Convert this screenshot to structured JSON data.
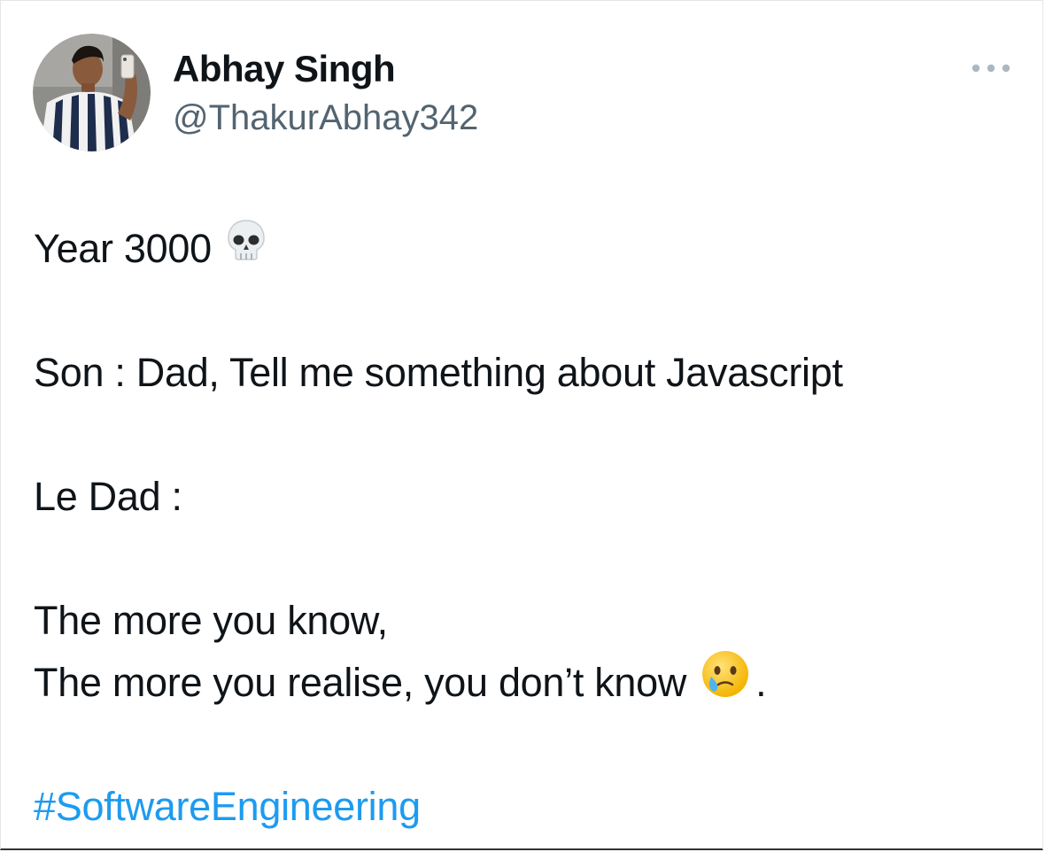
{
  "tweet": {
    "author": {
      "display_name": "Abhay Singh",
      "handle": "@ThakurAbhay342"
    },
    "more_icon": "more-horizontal-icon",
    "lines": {
      "l1": "Year 3000",
      "l1_emoji": "skull-emoji",
      "l2": "Son : Dad, Tell me something about Javascript",
      "l3": "Le Dad :",
      "l4": "The more you know,",
      "l5": "The more you realise, you don’t know",
      "l5_emoji": "face-holding-back-tears-emoji",
      "l5_tail": ".",
      "hashtag": "#SoftwareEngineering"
    },
    "colors": {
      "text": "#0f1419",
      "secondary": "#536471",
      "link": "#1d9bf0"
    }
  }
}
